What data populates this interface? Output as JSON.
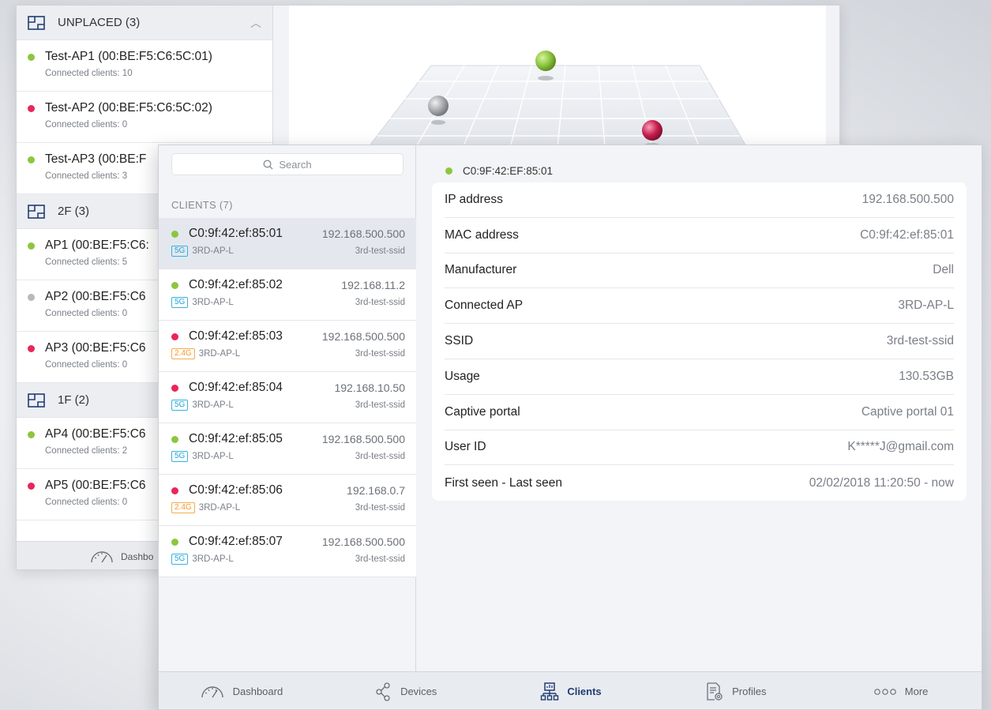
{
  "colors": {
    "online": "#8cc63f",
    "offline": "#e8265a",
    "idle": "#b7b9bd",
    "accent": "#213d72"
  },
  "back_window": {
    "groups": [
      {
        "name": "UNPLACED (3)",
        "collapse_icon": "chevron-up-icon",
        "items": [
          {
            "status": "online",
            "name": "Test-AP1 (00:BE:F5:C6:5C:01)",
            "sub": "Connected clients: 10"
          },
          {
            "status": "offline",
            "name": "Test-AP2 (00:BE:F5:C6:5C:02)",
            "sub": "Connected clients: 0"
          },
          {
            "status": "online",
            "name": "Test-AP3 (00:BE:F",
            "sub": "Connected clients: 3"
          }
        ]
      },
      {
        "name": "2F (3)",
        "items": [
          {
            "status": "online",
            "name": "AP1 (00:BE:F5:C6:",
            "sub": "Connected clients: 5"
          },
          {
            "status": "idle",
            "name": "AP2 (00:BE:F5:C6",
            "sub": "Connected clients: 0"
          },
          {
            "status": "offline",
            "name": "AP3 (00:BE:F5:C6",
            "sub": "Connected clients: 0"
          }
        ]
      },
      {
        "name": "1F (2)",
        "items": [
          {
            "status": "online",
            "name": "AP4 (00:BE:F5:C6",
            "sub": "Connected clients: 2"
          },
          {
            "status": "offline",
            "name": "AP5 (00:BE:F5:C6",
            "sub": "Connected clients: 0"
          }
        ]
      }
    ],
    "dashboard_label": "Dashbo"
  },
  "front_window": {
    "search_placeholder": "Search",
    "clients_title": "CLIENTS (7)",
    "clients": [
      {
        "status": "online",
        "mac": "C0:9f:42:ef:85:01",
        "ip": "192.168.500.500",
        "band": "5G",
        "ap": "3RD-AP-L",
        "ssid": "3rd-test-ssid",
        "selected": true
      },
      {
        "status": "online",
        "mac": "C0:9f:42:ef:85:02",
        "ip": "192.168.11.2",
        "band": "5G",
        "ap": "3RD-AP-L",
        "ssid": "3rd-test-ssid"
      },
      {
        "status": "offline",
        "mac": "C0:9f:42:ef:85:03",
        "ip": "192.168.500.500",
        "band": "2.4G",
        "ap": "3RD-AP-L",
        "ssid": "3rd-test-ssid"
      },
      {
        "status": "offline",
        "mac": "C0:9f:42:ef:85:04",
        "ip": "192.168.10.50",
        "band": "5G",
        "ap": "3RD-AP-L",
        "ssid": "3rd-test-ssid"
      },
      {
        "status": "online",
        "mac": "C0:9f:42:ef:85:05",
        "ip": "192.168.500.500",
        "band": "5G",
        "ap": "3RD-AP-L",
        "ssid": "3rd-test-ssid"
      },
      {
        "status": "offline",
        "mac": "C0:9f:42:ef:85:06",
        "ip": "192.168.0.7",
        "band": "2.4G",
        "ap": "3RD-AP-L",
        "ssid": "3rd-test-ssid"
      },
      {
        "status": "online",
        "mac": "C0:9f:42:ef:85:07",
        "ip": "192.168.500.500",
        "band": "5G",
        "ap": "3RD-AP-L",
        "ssid": "3rd-test-ssid"
      }
    ],
    "detail": {
      "status": "online",
      "title": "C0:9F:42:EF:85:01",
      "rows": [
        {
          "label": "IP address",
          "value": "192.168.500.500"
        },
        {
          "label": "MAC address",
          "value": "C0:9f:42:ef:85:01"
        },
        {
          "label": "Manufacturer",
          "value": "Dell"
        },
        {
          "label": "Connected AP",
          "value": "3RD-AP-L"
        },
        {
          "label": "SSID",
          "value": "3rd-test-ssid"
        },
        {
          "label": "Usage",
          "value": "130.53GB"
        },
        {
          "label": "Captive portal",
          "value": "Captive portal 01"
        },
        {
          "label": "User ID",
          "value": "K*****J@gmail.com"
        },
        {
          "label": "First seen - Last seen",
          "value": "02/02/2018 11:20:50 - now"
        }
      ]
    },
    "tabs": [
      {
        "label": "Dashboard",
        "icon": "dashboard-gauge-icon"
      },
      {
        "label": "Devices",
        "icon": "devices-share-icon"
      },
      {
        "label": "Clients",
        "icon": "clients-network-icon",
        "active": true
      },
      {
        "label": "Profiles",
        "icon": "profiles-document-icon"
      },
      {
        "label": "More",
        "icon": "more-dots-icon"
      }
    ]
  }
}
